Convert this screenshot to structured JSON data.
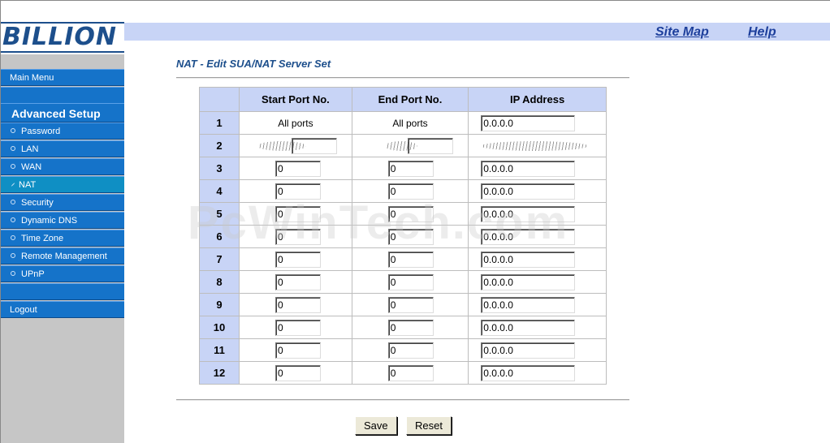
{
  "brand": "BILLION",
  "header": {
    "site_map": "Site Map",
    "help": "Help"
  },
  "sidebar": {
    "main_menu": "Main Menu",
    "section": "Advanced Setup",
    "items": [
      "Password",
      "LAN",
      "WAN",
      "NAT",
      "Security",
      "Dynamic DNS",
      "Time Zone",
      "Remote Management",
      "UPnP"
    ],
    "active": "NAT",
    "logout": "Logout"
  },
  "page": {
    "title": "NAT - Edit SUA/NAT Server Set"
  },
  "table": {
    "headers": [
      "",
      "Start Port No.",
      "End Port No.",
      "IP Address"
    ],
    "row1": {
      "num": "1",
      "start": "All ports",
      "end": "All ports",
      "ip": "0.0.0.0"
    },
    "row2": {
      "num": "2"
    },
    "rows": [
      {
        "num": "3",
        "start": "0",
        "end": "0",
        "ip": "0.0.0.0"
      },
      {
        "num": "4",
        "start": "0",
        "end": "0",
        "ip": "0.0.0.0"
      },
      {
        "num": "5",
        "start": "0",
        "end": "0",
        "ip": "0.0.0.0"
      },
      {
        "num": "6",
        "start": "0",
        "end": "0",
        "ip": "0.0.0.0"
      },
      {
        "num": "7",
        "start": "0",
        "end": "0",
        "ip": "0.0.0.0"
      },
      {
        "num": "8",
        "start": "0",
        "end": "0",
        "ip": "0.0.0.0"
      },
      {
        "num": "9",
        "start": "0",
        "end": "0",
        "ip": "0.0.0.0"
      },
      {
        "num": "10",
        "start": "0",
        "end": "0",
        "ip": "0.0.0.0"
      },
      {
        "num": "11",
        "start": "0",
        "end": "0",
        "ip": "0.0.0.0"
      },
      {
        "num": "12",
        "start": "0",
        "end": "0",
        "ip": "0.0.0.0"
      }
    ]
  },
  "buttons": {
    "save": "Save",
    "reset": "Reset"
  },
  "watermark": "PcWinTech.com",
  "colors": {
    "nav_blue": "#1573c9",
    "header_bg": "#c8d4f6",
    "title_blue": "#1d4f8c",
    "sidebar_bg": "#c6c6c6"
  }
}
